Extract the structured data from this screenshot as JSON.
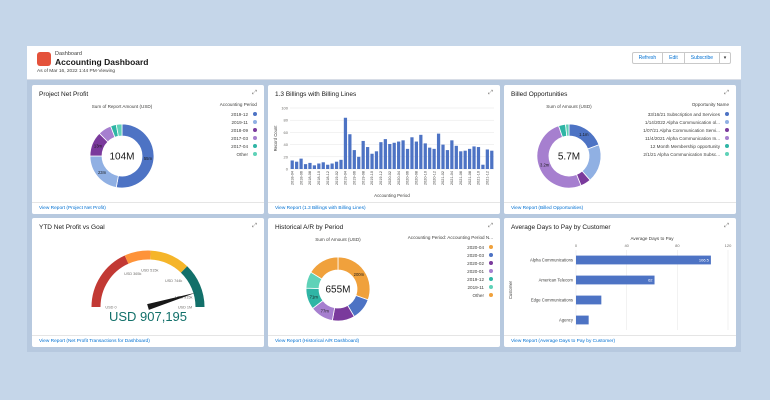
{
  "header": {
    "crumb": "Dashboard",
    "title": "Accounting Dashboard",
    "as_of": "As of Mar 16, 2022 1:44 PM·Viewing",
    "buttons": [
      "Refresh",
      "Edit",
      "Subscribe"
    ],
    "menu_glyph": "▾"
  },
  "icons": {
    "expand": "⤢"
  },
  "cards": {
    "net_profit": {
      "title": "Project Net Profit",
      "measure_label": "Sum of Report Amount (USD)",
      "center": "104M",
      "legend_title": "Accounting Period",
      "footer": "View Report (Project Net Profit)"
    },
    "billings": {
      "title": "1.3 Billings with Billing Lines",
      "y_label": "Record Count",
      "x_label": "Accounting Period",
      "footer": "View Report (1.3 Billings with Billing Lines)"
    },
    "billed_opps": {
      "title": "Billed Opportunities",
      "measure_label": "Sum of Amount (USD)",
      "center": "5.7M",
      "legend_title": "Opportunity Name",
      "footer": "View Report (Billed Opportunities)"
    },
    "ytd": {
      "title": "YTD Net Profit vs Goal",
      "value": "USD 907,195",
      "band_labels": [
        "USD 0",
        "USD 365k",
        "USD 515k",
        "USD 744k",
        "USD 915k",
        "USD 1M"
      ],
      "footer": "View Report (Net Profit Transactions for Dashboard)"
    },
    "ar": {
      "title": "Historical A/R by Period",
      "measure_label": "Sum of Amount (USD)",
      "center": "655M",
      "legend_title": "Accounting Period: Accounting Period N...",
      "footer": "View Report (Historical A/R Dashboard)"
    },
    "days": {
      "title": "Average Days to Pay by Customer",
      "measure_label": "Average Days to Pay",
      "y_label": "Customer",
      "footer": "View Report (Average Days to Pay by Customer)"
    }
  },
  "chart_data": [
    {
      "type": "donut",
      "title": "Project Net Profit",
      "series": [
        {
          "name": "2019-12",
          "value": 55,
          "label": "55m",
          "color": "#4d73c4"
        },
        {
          "name": "2019-11",
          "value": 23,
          "label": "23m",
          "color": "#90b0e3"
        },
        {
          "name": "2018-09",
          "value": 13,
          "label": "13m",
          "color": "#7a3a9c"
        },
        {
          "name": "2017-03",
          "value": 7,
          "label": "",
          "color": "#a67fcf"
        },
        {
          "name": "2017-04",
          "value": 3,
          "label": "",
          "color": "#2fb5a5"
        },
        {
          "name": "Other",
          "value": 3,
          "label": "",
          "color": "#5fd2b8"
        }
      ]
    },
    {
      "type": "bar",
      "title": "1.3 Billings with Billing Lines",
      "ylim": [
        0,
        100
      ],
      "y_ticks": [
        0,
        20,
        40,
        60,
        80,
        100
      ],
      "color": "#4d73c4",
      "categories": [
        "2018-04",
        "",
        "2018-06",
        "",
        "2018-08",
        "",
        "2018-10",
        "",
        "2018-12",
        "",
        "2019-02",
        "",
        "2019-04",
        "",
        "2019-06",
        "",
        "2019-08",
        "",
        "2019-10",
        "",
        "2019-12",
        "",
        "2020-02",
        "",
        "2020-04",
        "",
        "2020-06",
        "",
        "2020-08",
        "",
        "2020-10",
        "",
        "2020-12",
        "",
        "2021-02",
        "",
        "2021-04",
        "",
        "2021-06",
        "",
        "2021-08",
        "",
        "2021-10",
        "",
        "2021-12",
        "",
        "2022-02",
        ""
      ],
      "values": [
        14,
        12,
        17,
        8,
        10,
        6,
        9,
        11,
        7,
        9,
        12,
        15,
        84,
        57,
        31,
        20,
        46,
        36,
        25,
        29,
        44,
        49,
        41,
        43,
        45,
        47,
        33,
        52,
        45,
        56,
        42,
        35,
        33,
        58,
        40,
        31,
        47,
        38,
        29,
        30,
        33,
        37,
        36,
        7,
        32,
        30
      ]
    },
    {
      "type": "donut",
      "title": "Billed Opportunities",
      "series": [
        {
          "name": "33/16/21 Subscription and Services",
          "value": 1.1,
          "label": "1.1m",
          "color": "#4d73c4"
        },
        {
          "name": "1/14/2022 Alpha Communication ol...",
          "value": 1.1,
          "label": "",
          "color": "#90b0e3"
        },
        {
          "name": "1/07/21 Alpha Communication Servi...",
          "value": 0.3,
          "label": "",
          "color": "#7a3a9c"
        },
        {
          "name": "11/4/2021 Alpha Communication In...",
          "value": 2.9,
          "label": "3.2m",
          "color": "#a67fcf"
        },
        {
          "name": "12 Month Membership opportunity",
          "value": 0.2,
          "label": "",
          "color": "#2fb5a5"
        },
        {
          "name": "2/1/21 Alpha Communication Subsc...",
          "value": 0.1,
          "label": "",
          "color": "#5fd2b8"
        }
      ]
    },
    {
      "type": "gauge",
      "title": "YTD Net Profit vs Goal",
      "value": 907195,
      "min": 0,
      "max": 1000000,
      "bands": [
        {
          "to": 0.365,
          "color": "#c23934"
        },
        {
          "to": 0.515,
          "color": "#fe9339"
        },
        {
          "to": 0.744,
          "color": "#f5b52a"
        },
        {
          "to": 1.0,
          "color": "#12706a"
        }
      ]
    },
    {
      "type": "donut",
      "title": "Historical A/R by Period",
      "series": [
        {
          "name": "2020-04",
          "value": 200,
          "label": "200m",
          "color": "#f0a13c"
        },
        {
          "name": "2020-03",
          "value": 72,
          "label": "",
          "color": "#4d73c4"
        },
        {
          "name": "2020-02",
          "value": 74,
          "label": "",
          "color": "#7a3a9c"
        },
        {
          "name": "2020-01",
          "value": 77,
          "label": "77m",
          "color": "#a67fcf"
        },
        {
          "name": "2019-12",
          "value": 71,
          "label": "71m",
          "color": "#2fb5a5"
        },
        {
          "name": "2019-11",
          "value": 55,
          "label": "",
          "color": "#5fd2b8"
        },
        {
          "name": "Other",
          "value": 106,
          "label": "",
          "color": "#f0a13c"
        }
      ]
    },
    {
      "type": "hbar",
      "title": "Average Days to Pay by Customer",
      "xlim": [
        0,
        120
      ],
      "x_ticks": [
        0,
        40,
        80,
        120
      ],
      "color": "#4d73c4",
      "categories": [
        "Alpha Communications",
        "American Telecom",
        "Edge Communications",
        "Agency"
      ],
      "values": [
        106.5,
        62,
        20,
        10
      ],
      "value_labels": [
        "106.5",
        "62",
        "",
        ""
      ]
    }
  ]
}
